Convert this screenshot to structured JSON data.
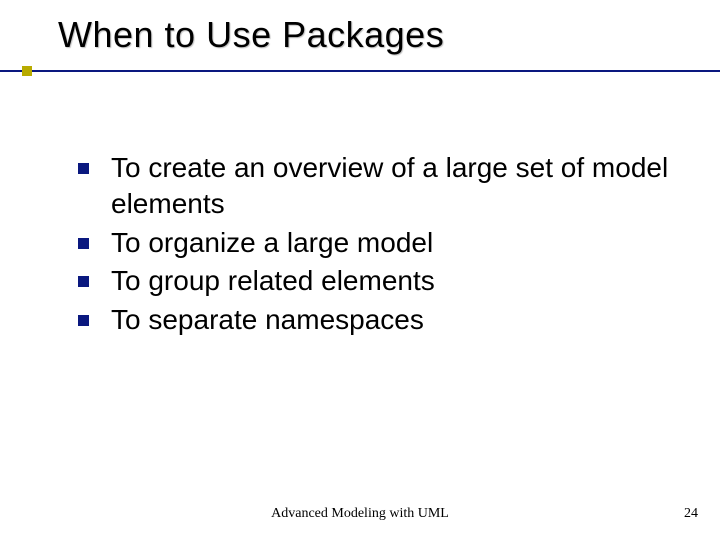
{
  "title": "When to Use Packages",
  "bullets": [
    "To create an overview of a large set of model elements",
    "To organize a large model",
    "To group related elements",
    "To separate namespaces"
  ],
  "footer": {
    "center": "Advanced Modeling with UML",
    "page": "24"
  }
}
